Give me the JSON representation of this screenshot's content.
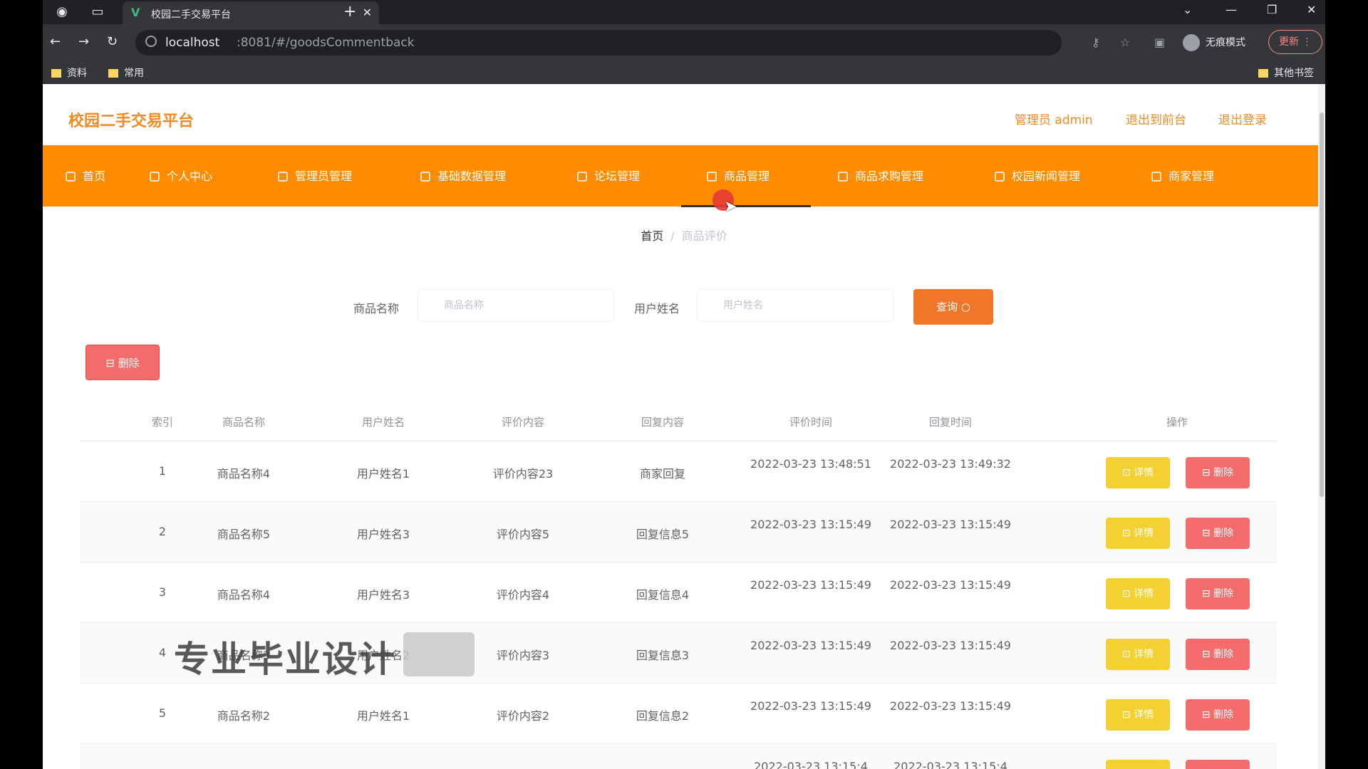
{
  "browser": {
    "tab_title": "校园二手交易平台",
    "favicon": "V",
    "url_host": "localhost",
    "url_path": ":8081/#/goodsCommentback",
    "incognito_label": "无痕模式",
    "update_label": "更新",
    "bookmarks": [
      "资料",
      "常用"
    ],
    "other_bookmarks": "其他书签"
  },
  "header": {
    "brand": "校园二手交易平台",
    "admin_label": "管理员 admin",
    "exit_to_front": "退出到前台",
    "logout": "退出登录"
  },
  "menu": [
    "首页",
    "个人中心",
    "管理员管理",
    "基础数据管理",
    "论坛管理",
    "商品管理",
    "商品求购管理",
    "校园新闻管理",
    "商家管理"
  ],
  "breadcrumb": {
    "home": "首页",
    "separator": "/",
    "current": "商品评价"
  },
  "search": {
    "goods_label": "商品名称",
    "goods_placeholder": "商品名称",
    "user_label": "用户姓名",
    "user_placeholder": "用户姓名",
    "query_button": "查询 ○"
  },
  "batch_delete": "⊟ 删除",
  "table": {
    "headers": [
      "索引",
      "商品名称",
      "用户姓名",
      "评价内容",
      "回复内容",
      "评价时间",
      "回复时间",
      "操作"
    ],
    "rows": [
      {
        "index": "1",
        "goods": "商品名称4",
        "user": "用户姓名1",
        "comment": "评价内容23",
        "reply": "商家回复",
        "comment_time": "2022-03-23 13:48:51",
        "reply_time": "2022-03-23 13:49:32"
      },
      {
        "index": "2",
        "goods": "商品名称5",
        "user": "用户姓名3",
        "comment": "评价内容5",
        "reply": "回复信息5",
        "comment_time": "2022-03-23 13:15:49",
        "reply_time": "2022-03-23 13:15:49"
      },
      {
        "index": "3",
        "goods": "商品名称4",
        "user": "用户姓名3",
        "comment": "评价内容4",
        "reply": "回复信息4",
        "comment_time": "2022-03-23 13:15:49",
        "reply_time": "2022-03-23 13:15:49"
      },
      {
        "index": "4",
        "goods": "商品名称3",
        "user": "用户姓名2",
        "comment": "评价内容3",
        "reply": "回复信息3",
        "comment_time": "2022-03-23 13:15:49",
        "reply_time": "2022-03-23 13:15:49"
      },
      {
        "index": "5",
        "goods": "商品名称2",
        "user": "用户姓名1",
        "comment": "评价内容2",
        "reply": "回复信息2",
        "comment_time": "2022-03-23 13:15:49",
        "reply_time": "2022-03-23 13:15:49"
      }
    ],
    "partial_row": {
      "comment_time": "2022-03-23 13:15:4",
      "reply_time": "2022-03-23 13:15:4"
    },
    "detail_button": "⊡ 详情",
    "delete_button": "⊟ 删除"
  },
  "watermark": "专业毕业设计",
  "colors": {
    "accent": "#ff8c00",
    "brand": "#f08a24",
    "danger": "#f56c6c",
    "warning": "#f5d033"
  }
}
